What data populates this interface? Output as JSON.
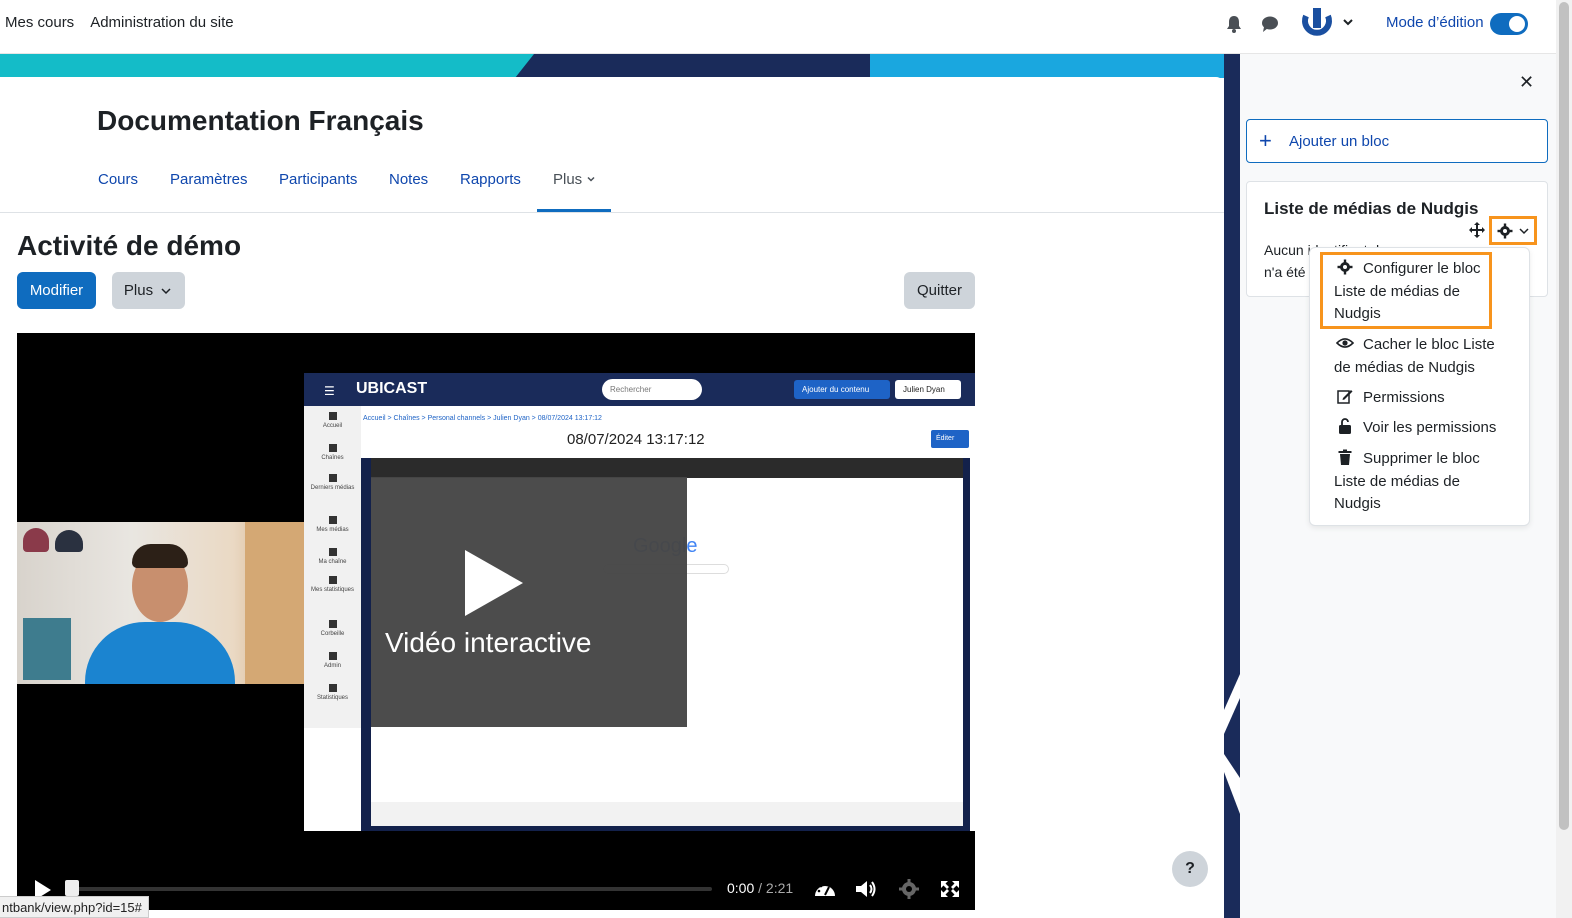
{
  "topbar": {
    "nav": [
      "Mes cours",
      "Administration du site"
    ],
    "edit_mode_label": "Mode d’édition",
    "edit_mode_on": true
  },
  "course": {
    "title": "Documentation Français",
    "tabs": [
      "Cours",
      "Paramètres",
      "Participants",
      "Notes",
      "Rapports",
      "Plus"
    ],
    "active_tab": "Plus"
  },
  "activity": {
    "title": "Activité de démo",
    "modifier_label": "Modifier",
    "plus_label": "Plus",
    "quitter_label": "Quitter"
  },
  "video": {
    "overlay_label": "Vidéo interactive",
    "current_time": "0:00",
    "duration": "2:21",
    "progress": 0,
    "screen": {
      "logo": "UBICAST",
      "search_placeholder": "Rechercher",
      "add_content": "Ajouter du contenu",
      "user": "Julien Dyan",
      "breadcrumb": "Accueil > Chaînes > Personal channels > Julien Dyan > 08/07/2024 13:17:12",
      "date_title": "08/07/2024 13:17:12",
      "edit": "Éditer",
      "google": "Google",
      "sidebar": [
        "Accueil",
        "Chaînes",
        "Derniers médias",
        "Mes médias",
        "Ma chaîne",
        "Mes statistiques",
        "Corbeille",
        "Admin",
        "Statistiques"
      ]
    }
  },
  "drawer": {
    "add_block_label": "Ajouter un bloc",
    "block_title": "Liste de médias de Nudgis",
    "block_text": "Aucun identifiant de ressource n'a été",
    "menu": [
      {
        "icon": "gear-icon",
        "label": "Configurer le bloc Liste de médias de Nudgis"
      },
      {
        "icon": "eye-icon",
        "label": "Cacher le bloc Liste de médias de Nudgis"
      },
      {
        "icon": "edit-icon",
        "label": "Permissions"
      },
      {
        "icon": "unlock-icon",
        "label": "Voir les permissions"
      },
      {
        "icon": "trash-icon",
        "label": "Supprimer le bloc Liste de médias de Nudgis"
      }
    ]
  },
  "status_url": "ntbank/view.php?id=15#",
  "help_label": "?",
  "colors": {
    "primary": "#0f6cbf",
    "link": "#0f47ad",
    "highlight": "#f7941d",
    "banner_teal": "#14bcc8",
    "banner_dark": "#1a2b5a"
  }
}
